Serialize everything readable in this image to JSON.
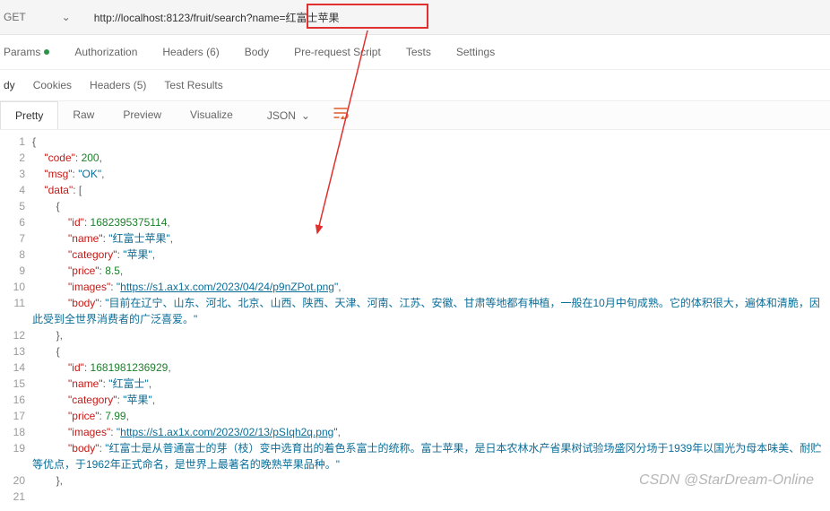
{
  "request": {
    "method": "GET",
    "url": "http://localhost:8123/fruit/search?name=红富士苹果"
  },
  "req_tabs": {
    "params": "Params",
    "authorization": "Authorization",
    "headers": "Headers (6)",
    "body": "Body",
    "prerequest": "Pre-request Script",
    "tests": "Tests",
    "settings": "Settings"
  },
  "resp_tabs": {
    "body_sub": "dy",
    "cookies": "Cookies",
    "headers": "Headers (5)",
    "tests": "Test Results"
  },
  "view_tabs": {
    "pretty": "Pretty",
    "raw": "Raw",
    "preview": "Preview",
    "visualize": "Visualize",
    "type": "JSON"
  },
  "json": {
    "code": 200,
    "msg": "OK",
    "items": [
      {
        "id": 1682395375114,
        "name": "红富士苹果",
        "category": "苹果",
        "price": 8.5,
        "images": "https://s1.ax1x.com/2023/04/24/p9nZPot.png",
        "body": "目前在辽宁、山东、河北、北京、山西、陕西、天津、河南、江苏、安徽、甘肃等地都有种植，一般在10月中旬成熟。它的体积很大，遍体和清脆，因此受到全世界消费者的广泛喜爱。"
      },
      {
        "id": 1681981236929,
        "name": "红富士",
        "category": "苹果",
        "price": 7.99,
        "images": "https://s1.ax1x.com/2023/02/13/pSIqh2q.png",
        "body": "红富士是从普通富士的芽（枝）变中选育出的着色系富士的统称。富士苹果，是日本农林水产省果树试验场盛冈分场于1939年以国光为母本味美、耐贮等优点，于1962年正式命名，是世界上最著名的晚熟苹果品种。"
      }
    ]
  },
  "watermark": "CSDN @StarDream-Online"
}
